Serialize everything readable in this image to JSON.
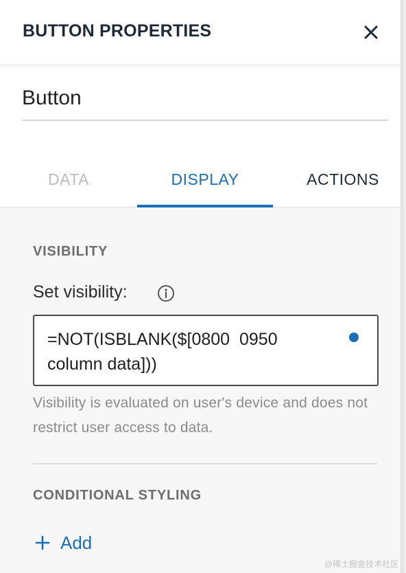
{
  "header": {
    "title": "BUTTON PROPERTIES",
    "close_icon": "close-icon"
  },
  "name_field": {
    "value": "Button"
  },
  "tabs": [
    {
      "label": "DATA",
      "state": "disabled"
    },
    {
      "label": "DISPLAY",
      "state": "active"
    },
    {
      "label": "ACTIONS",
      "state": "inactive"
    }
  ],
  "visibility": {
    "section_title": "VISIBILITY",
    "label": "Set visibility:",
    "info_icon": "info-icon",
    "formula": "=NOT(ISBLANK($[0800  0950 column data]))",
    "helper_text": "Visibility is evaluated on user's device and does not restrict user access to data."
  },
  "conditional_styling": {
    "section_title": "CONDITIONAL STYLING",
    "add_label": "Add",
    "add_icon": "plus-icon"
  },
  "watermark": "@稀土掘金技术社区",
  "colors": {
    "accent": "#1b6fb6",
    "title": "#1f2a36",
    "disabled_tab": "#bcbcbc",
    "section_title": "#6d6d6d",
    "helper_text": "#8a8a8a",
    "content_bg": "#f7f7f7"
  }
}
